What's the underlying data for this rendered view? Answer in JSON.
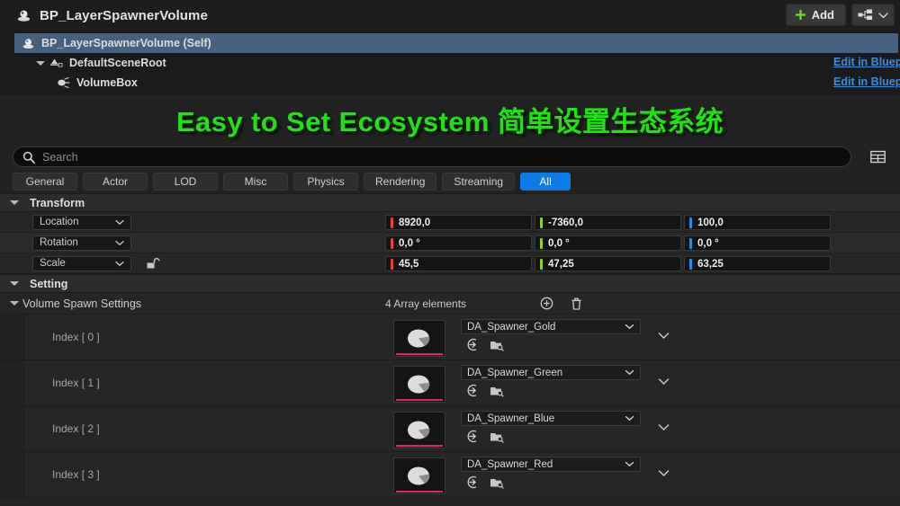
{
  "header": {
    "object_icon": "blueprint-actor-icon",
    "title": "BP_LayerSpawnerVolume",
    "add_label": "Add",
    "add_icon": "plus-icon",
    "view_options_icon": "hierarchy-view-icon",
    "view_options_chevron": "chevron-down-icon"
  },
  "tree": {
    "rows": [
      {
        "label": "BP_LayerSpawnerVolume (Self)",
        "icon": "blueprint-actor-icon",
        "selected": true,
        "indent": 0,
        "has_caret": false,
        "link": ""
      },
      {
        "label": "DefaultSceneRoot",
        "icon": "scene-root-icon",
        "selected": false,
        "indent": 1,
        "has_caret": true,
        "link": "Edit in Blueprint"
      },
      {
        "label": "VolumeBox",
        "icon": "volume-box-icon",
        "selected": false,
        "indent": 2,
        "has_caret": false,
        "link": "Edit in Blueprint"
      }
    ]
  },
  "banner": {
    "text": "Easy to Set Ecosystem 简单设置生态系统",
    "color": "#23e016"
  },
  "search": {
    "placeholder": "Search",
    "value": "",
    "icon": "search-icon",
    "grid_icon": "table-settings-icon"
  },
  "filter_tabs": [
    {
      "label": "General",
      "active": false
    },
    {
      "label": "Actor",
      "active": false
    },
    {
      "label": "LOD",
      "active": false
    },
    {
      "label": "Misc",
      "active": false
    },
    {
      "label": "Physics",
      "active": false
    },
    {
      "label": "Rendering",
      "active": false
    },
    {
      "label": "Streaming",
      "active": false
    },
    {
      "label": "All",
      "active": true
    }
  ],
  "transform": {
    "category": "Transform",
    "caret": "caret-down-icon",
    "rows": [
      {
        "name": "Location",
        "chevron": "chevron-down-icon",
        "lock": false,
        "fields": [
          {
            "axis": "X",
            "color": "#e4442c",
            "value": "8920,0"
          },
          {
            "axis": "Y",
            "color": "#8ed12a",
            "value": "-7360,0"
          },
          {
            "axis": "Z",
            "color": "#2d8ae8",
            "value": "100,0"
          }
        ]
      },
      {
        "name": "Rotation",
        "chevron": "chevron-down-icon",
        "lock": false,
        "fields": [
          {
            "axis": "X",
            "color": "#e4442c",
            "value": "0,0 °"
          },
          {
            "axis": "Y",
            "color": "#8ed12a",
            "value": "0,0 °"
          },
          {
            "axis": "Z",
            "color": "#2d8ae8",
            "value": "0,0 °"
          }
        ]
      },
      {
        "name": "Scale",
        "chevron": "chevron-down-icon",
        "lock": true,
        "lock_icon": "unlocked-padlock-icon",
        "fields": [
          {
            "axis": "X",
            "color": "#e4442c",
            "value": "45,5"
          },
          {
            "axis": "Y",
            "color": "#8ed12a",
            "value": "47,25"
          },
          {
            "axis": "Z",
            "color": "#2d8ae8",
            "value": "63,25"
          }
        ]
      }
    ]
  },
  "setting": {
    "category": "Setting",
    "caret": "caret-down-icon",
    "array": {
      "label": "Volume Spawn Settings",
      "caret": "caret-down-icon",
      "count_text": "4 Array elements",
      "add_icon": "add-element-icon",
      "delete_icon": "trash-icon",
      "elements": [
        {
          "index_label": "Index [ 0 ]",
          "asset": "DA_Spawner_Gold",
          "thumb_icon": "data-asset-pie-icon",
          "dropdown_chevron": "chevron-down-icon",
          "use_selected_icon": "use-selected-asset-icon",
          "browse_icon": "browse-to-asset-icon",
          "expand_chevron": "chevron-down-icon"
        },
        {
          "index_label": "Index [ 1 ]",
          "asset": "DA_Spawner_Green",
          "thumb_icon": "data-asset-pie-icon",
          "dropdown_chevron": "chevron-down-icon",
          "use_selected_icon": "use-selected-asset-icon",
          "browse_icon": "browse-to-asset-icon",
          "expand_chevron": "chevron-down-icon"
        },
        {
          "index_label": "Index [ 2 ]",
          "asset": "DA_Spawner_Blue",
          "thumb_icon": "data-asset-pie-icon",
          "dropdown_chevron": "chevron-down-icon",
          "use_selected_icon": "use-selected-asset-icon",
          "browse_icon": "browse-to-asset-icon",
          "expand_chevron": "chevron-down-icon"
        },
        {
          "index_label": "Index [ 3 ]",
          "asset": "DA_Spawner_Red",
          "thumb_icon": "data-asset-pie-icon",
          "dropdown_chevron": "chevron-down-icon",
          "use_selected_icon": "use-selected-asset-icon",
          "browse_icon": "browse-to-asset-icon",
          "expand_chevron": "chevron-down-icon"
        }
      ]
    }
  }
}
